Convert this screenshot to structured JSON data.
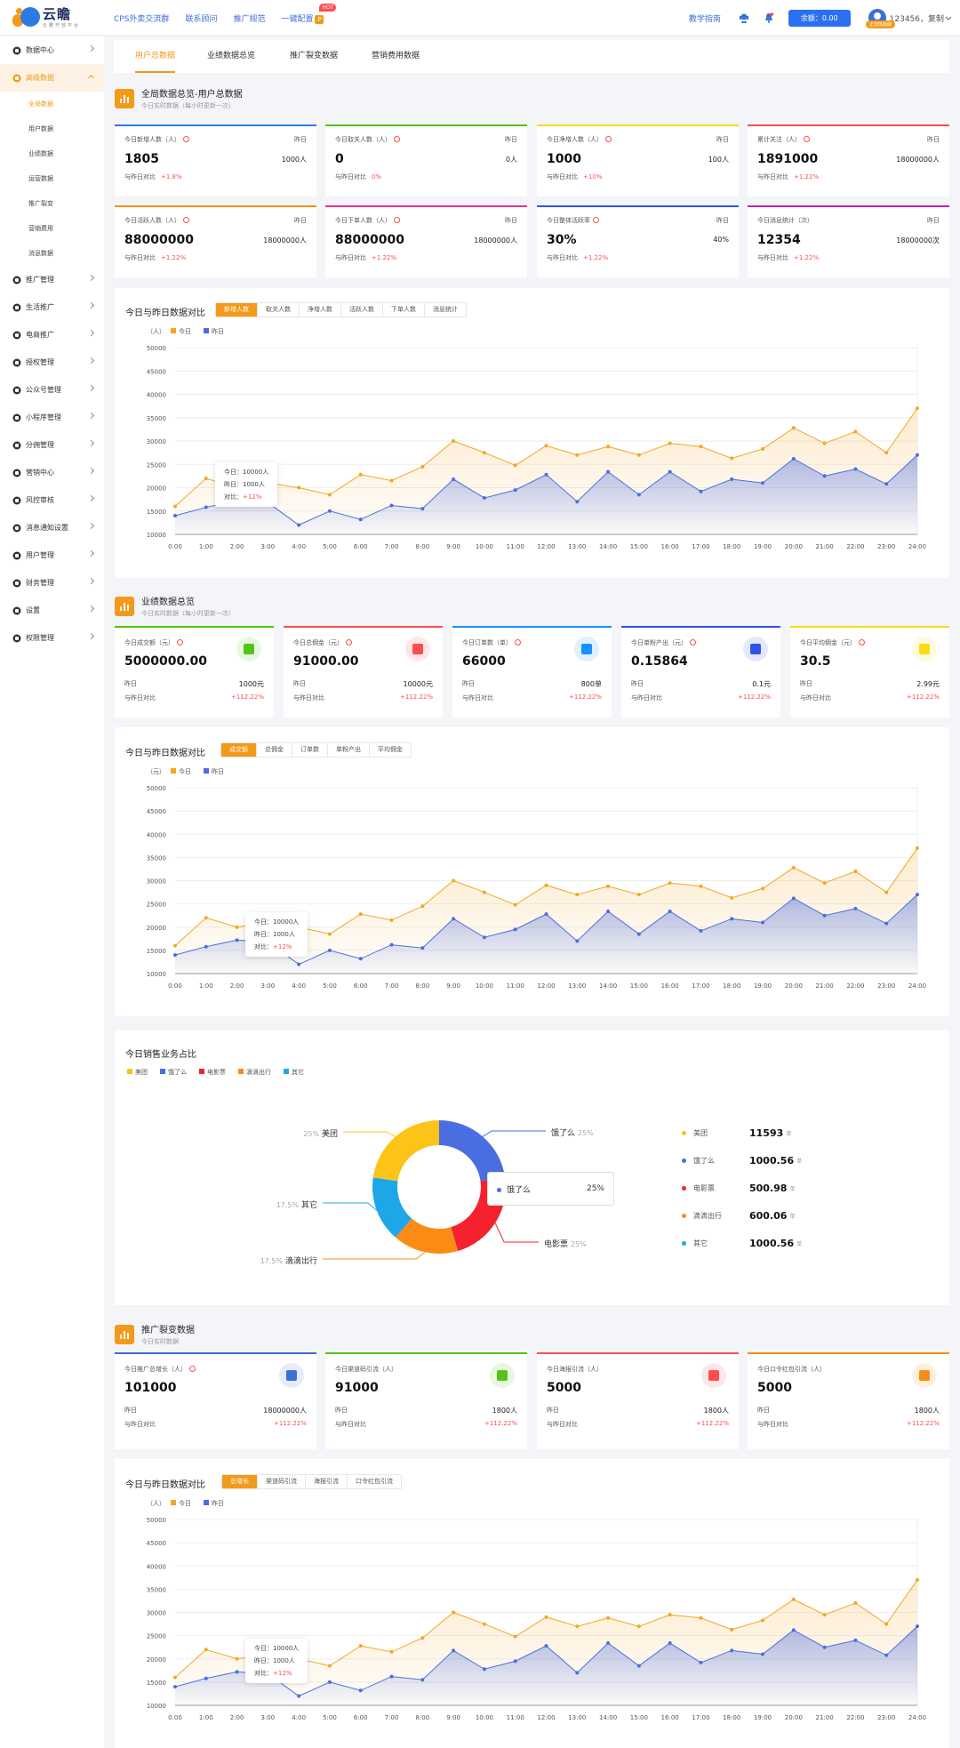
{
  "header": {
    "logo_text": "云瞻",
    "logo_sub": "云瞻开放平台",
    "nav": [
      "CPS外卖交流群",
      "联系顾问",
      "推广规范",
      "一键配置"
    ],
    "hot": "HOT",
    "guide": "教学指南",
    "balance": "余额：0.00",
    "user": "123456，复制",
    "user_badge": "正式体验版"
  },
  "sidebar": {
    "items": [
      {
        "label": "数据中心",
        "icon": "chart-icon"
      },
      {
        "label": "高级数据",
        "icon": "layers-icon",
        "active": true
      },
      {
        "label": "推广管理",
        "icon": "grid-icon"
      },
      {
        "label": "生活推广",
        "icon": "store-icon"
      },
      {
        "label": "电商推广",
        "icon": "shop-icon"
      },
      {
        "label": "授权管理",
        "icon": "user-lock-icon"
      },
      {
        "label": "公众号管理",
        "icon": "wechat-icon"
      },
      {
        "label": "小程序管理",
        "icon": "miniapp-icon"
      },
      {
        "label": "分佣管理",
        "icon": "commission-icon"
      },
      {
        "label": "营销中心",
        "icon": "gift-icon"
      },
      {
        "label": "风控审核",
        "icon": "shield-icon"
      },
      {
        "label": "消息通知设置",
        "icon": "message-icon"
      },
      {
        "label": "用户管理",
        "icon": "users-icon"
      },
      {
        "label": "财务管理",
        "icon": "wallet-icon"
      },
      {
        "label": "设置",
        "icon": "gear-icon"
      },
      {
        "label": "权限管理",
        "icon": "key-icon"
      }
    ],
    "sub": [
      "全局数据",
      "用户数据",
      "业绩数据",
      "运营数据",
      "推广裂变",
      "营销费用",
      "消息数据"
    ]
  },
  "tabs": [
    "用户总数据",
    "业绩数据总览",
    "推广裂变数据",
    "营销费用数据"
  ],
  "section1": {
    "title": "全局数据总览-用户总数据",
    "subtitle": "今日实时数据（每小时更新一次）"
  },
  "user_cards": [
    {
      "title": "今日新增人数（人）",
      "yday_label": "昨日",
      "value": "1805",
      "yday": "1000人",
      "cmp_label": "与昨日对比",
      "cmp": "+1.8%",
      "color": "#2c7be5"
    },
    {
      "title": "今日取关人数（人）",
      "yday_label": "昨日",
      "value": "0",
      "yday": "0人",
      "cmp_label": "与昨日对比",
      "cmp": "0%",
      "color": "#52c41a"
    },
    {
      "title": "今日净增人数（人）",
      "yday_label": "昨日",
      "value": "1000",
      "yday": "100人",
      "cmp_label": "与昨日对比",
      "cmp": "+10%",
      "color": "#fadb14"
    },
    {
      "title": "累计关注（人）",
      "yday_label": "昨日",
      "value": "1891000",
      "yday": "18000000人",
      "cmp_label": "与昨日对比",
      "cmp": "+1.22%",
      "color": "#ff4d4f"
    },
    {
      "title": "今日活跃人数（人）",
      "yday_label": "昨日",
      "value": "88000000",
      "yday": "18000000人",
      "cmp_label": "与昨日对比",
      "cmp": "+1.22%",
      "color": "#fa8c16"
    },
    {
      "title": "今日下单人数（人）",
      "yday_label": "昨日",
      "value": "88000000",
      "yday": "18000000人",
      "cmp_label": "与昨日对比",
      "cmp": "+1.22%",
      "color": "#eb2f96"
    },
    {
      "title": "今日整体活跃率",
      "yday_label": "昨日",
      "value": "30%",
      "yday": "40%",
      "cmp_label": "与昨日对比",
      "cmp": "+1.22%",
      "color": "#2f54eb"
    },
    {
      "title": "今日消息统计（次）",
      "yday_label": "昨日",
      "value": "12354",
      "yday": "18000000次",
      "cmp_label": "与昨日对比",
      "cmp": "+1.22%",
      "color": "#c41dbc"
    }
  ],
  "chart1": {
    "title": "今日与昨日数据对比",
    "segments": [
      "新增人数",
      "取关人数",
      "净增人数",
      "活跃人数",
      "下单人数",
      "消息统计"
    ],
    "unit": "（人）"
  },
  "section2": {
    "title": "业绩数据总览",
    "subtitle": "今日实时数据（每小时更新一次）"
  },
  "perf_cards": [
    {
      "title": "今日成交额（元）",
      "value": "5000000.00",
      "r1l": "昨日",
      "r1r": "1000元",
      "r2l": "与昨日对比",
      "r2r": "+112.22%",
      "color": "#52c41a",
      "icon": "ticket-icon"
    },
    {
      "title": "今日总佣金（元）",
      "value": "91000.00",
      "r1l": "昨日",
      "r1r": "10000元",
      "r2l": "与昨日对比",
      "r2r": "+112.22%",
      "color": "#ff4d4f",
      "icon": "coins-icon"
    },
    {
      "title": "今日订单数（单）",
      "value": "66000",
      "r1l": "昨日",
      "r1r": "800单",
      "r2l": "与昨日对比",
      "r2r": "+112.22%",
      "color": "#1890ff",
      "icon": "cart-icon"
    },
    {
      "title": "今日单粉产出（元）",
      "value": "0.15864",
      "r1l": "昨日",
      "r1r": "0.1元",
      "r2l": "与昨日对比",
      "r2r": "+112.22%",
      "color": "#2f54eb",
      "icon": "fan-icon"
    },
    {
      "title": "今日平均佣金（元）",
      "value": "30.5",
      "r1l": "昨日",
      "r1r": "2.99元",
      "r2l": "与昨日对比",
      "r2r": "+112.22%",
      "color": "#fadb14",
      "icon": "money-icon"
    }
  ],
  "chart2": {
    "title": "今日与昨日数据对比",
    "segments": [
      "成交额",
      "总佣金",
      "订单数",
      "单粉产出",
      "平均佣金"
    ],
    "unit": "（元）"
  },
  "pie": {
    "title": "今日销售业务占比",
    "tooltip": {
      "name": "饿了么",
      "pct": "25%"
    },
    "list": [
      {
        "name": "美团",
        "value": "11593",
        "unit": "单",
        "color": "#fcc419"
      },
      {
        "name": "饿了么",
        "value": "1000.56",
        "unit": "单",
        "color": "#4a6ee0"
      },
      {
        "name": "电影票",
        "value": "500.98",
        "unit": "单",
        "color": "#f5222d"
      },
      {
        "name": "滴滴出行",
        "value": "600.06",
        "unit": "单",
        "color": "#fa8c16"
      },
      {
        "name": "其它",
        "value": "1000.56",
        "unit": "单",
        "color": "#1ea7e8"
      }
    ]
  },
  "section3": {
    "title": "推广裂变数据",
    "subtitle": "今日实时数据"
  },
  "promo_cards": [
    {
      "title": "今日推广总增长（人）",
      "value": "101000",
      "r1l": "昨日",
      "r1r": "18000000人",
      "r2l": "与昨日对比",
      "r2r": "+112.22%",
      "color": "#3b6fd8",
      "icon": "bars-icon"
    },
    {
      "title": "今日渠道码引流（人）",
      "value": "91000",
      "r1l": "昨日",
      "r1r": "1800人",
      "r2l": "与昨日对比",
      "r2r": "+112.22%",
      "color": "#52c41a",
      "icon": "qrcode-icon"
    },
    {
      "title": "今日海报引流（人）",
      "value": "5000",
      "r1l": "昨日",
      "r1r": "1800人",
      "r2l": "与昨日对比",
      "r2r": "+112.22%",
      "color": "#ff4d4f",
      "icon": "image-icon"
    },
    {
      "title": "今日口令红包引流（人）",
      "value": "5000",
      "r1l": "昨日",
      "r1r": "1800人",
      "r2l": "与昨日对比",
      "r2r": "+112.22%",
      "color": "#fa8c16",
      "icon": "redpacket-icon"
    }
  ],
  "chart3": {
    "title": "今日与昨日数据对比",
    "segments": [
      "总增长",
      "渠道码引流",
      "海报引流",
      "口令红包引流"
    ],
    "unit": "（人）"
  },
  "tooltip": {
    "today": "今日：10000人",
    "yday": "昨日：1000人",
    "cmp_label": "对比：",
    "cmp": "+12%"
  },
  "chart_data": [
    {
      "type": "area",
      "title": "今日与昨日数据对比",
      "ylabel": "（人）",
      "ylim": [
        10000,
        50000
      ],
      "yticks": [
        10000,
        15000,
        20000,
        25000,
        30000,
        35000,
        40000,
        45000,
        50000
      ],
      "x": [
        "0:00",
        "1:00",
        "2:00",
        "3:00",
        "4:00",
        "5:00",
        "6:00",
        "7:00",
        "8:00",
        "9:00",
        "10:00",
        "11:00",
        "12:00",
        "13:00",
        "14:00",
        "15:00",
        "16:00",
        "17:00",
        "18:00",
        "19:00",
        "20:00",
        "21:00",
        "22:00",
        "23:00",
        "24:00"
      ],
      "series": [
        {
          "name": "今日",
          "color": "#f5a623",
          "values": [
            16000,
            22000,
            20000,
            21000,
            20000,
            18500,
            22800,
            21500,
            24500,
            30000,
            27500,
            24800,
            29000,
            27000,
            28800,
            27000,
            29500,
            28800,
            26300,
            28300,
            32800,
            29500,
            32000,
            27500,
            37000
          ]
        },
        {
          "name": "昨日",
          "color": "#4a6ee0",
          "values": [
            14000,
            15800,
            17200,
            16800,
            12000,
            15000,
            13200,
            16200,
            15500,
            21800,
            17800,
            19500,
            22800,
            17000,
            23400,
            18500,
            23400,
            19200,
            21800,
            21000,
            26200,
            22500,
            24000,
            20800,
            27000
          ]
        }
      ]
    },
    {
      "type": "area",
      "title": "今日与昨日数据对比",
      "ylabel": "（元）",
      "ylim": [
        10000,
        50000
      ],
      "yticks": [
        10000,
        15000,
        20000,
        25000,
        30000,
        35000,
        40000,
        45000,
        50000
      ],
      "x": [
        "0:00",
        "1:00",
        "2:00",
        "3:00",
        "4:00",
        "5:00",
        "6:00",
        "7:00",
        "8:00",
        "9:00",
        "10:00",
        "11:00",
        "12:00",
        "13:00",
        "14:00",
        "15:00",
        "16:00",
        "17:00",
        "18:00",
        "19:00",
        "20:00",
        "21:00",
        "22:00",
        "23:00",
        "24:00"
      ],
      "series": [
        {
          "name": "今日",
          "color": "#f5a623",
          "values": [
            16000,
            22000,
            20000,
            21000,
            20000,
            18500,
            22800,
            21500,
            24500,
            30000,
            27500,
            24800,
            29000,
            27000,
            28800,
            27000,
            29500,
            28800,
            26300,
            28300,
            32800,
            29500,
            32000,
            27500,
            37000
          ]
        },
        {
          "name": "昨日",
          "color": "#4a6ee0",
          "values": [
            14000,
            15800,
            17200,
            16800,
            12000,
            15000,
            13200,
            16200,
            15500,
            21800,
            17800,
            19500,
            22800,
            17000,
            23400,
            18500,
            23400,
            19200,
            21800,
            21000,
            26200,
            22500,
            24000,
            20800,
            27000
          ]
        }
      ]
    },
    {
      "type": "pie",
      "title": "今日销售业务占比",
      "categories": [
        "饿了么",
        "电影票",
        "滴滴出行",
        "其它",
        "美团"
      ],
      "values": [
        25,
        25,
        17.5,
        17.5,
        25
      ],
      "labels": [
        "25%",
        "25%",
        "17.5%",
        "17.5%",
        "25%"
      ]
    },
    {
      "type": "area",
      "title": "今日与昨日数据对比",
      "ylabel": "（人）",
      "ylim": [
        10000,
        50000
      ],
      "yticks": [
        10000,
        15000,
        20000,
        25000,
        30000,
        35000,
        40000,
        45000,
        50000
      ],
      "x": [
        "0:00",
        "1:00",
        "2:00",
        "3:00",
        "4:00",
        "5:00",
        "6:00",
        "7:00",
        "8:00",
        "9:00",
        "10:00",
        "11:00",
        "12:00",
        "13:00",
        "14:00",
        "15:00",
        "16:00",
        "17:00",
        "18:00",
        "19:00",
        "20:00",
        "21:00",
        "22:00",
        "23:00",
        "24:00"
      ],
      "series": [
        {
          "name": "今日",
          "color": "#f5a623",
          "values": [
            16000,
            22000,
            20000,
            21000,
            20000,
            18500,
            22800,
            21500,
            24500,
            30000,
            27500,
            24800,
            29000,
            27000,
            28800,
            27000,
            29500,
            28800,
            26300,
            28300,
            32800,
            29500,
            32000,
            27500,
            37000
          ]
        },
        {
          "name": "昨日",
          "color": "#4a6ee0",
          "values": [
            14000,
            15800,
            17200,
            16800,
            12000,
            15000,
            13200,
            16200,
            15500,
            21800,
            17800,
            19500,
            22800,
            17000,
            23400,
            18500,
            23400,
            19200,
            21800,
            21000,
            26200,
            22500,
            24000,
            20800,
            27000
          ]
        }
      ]
    }
  ]
}
